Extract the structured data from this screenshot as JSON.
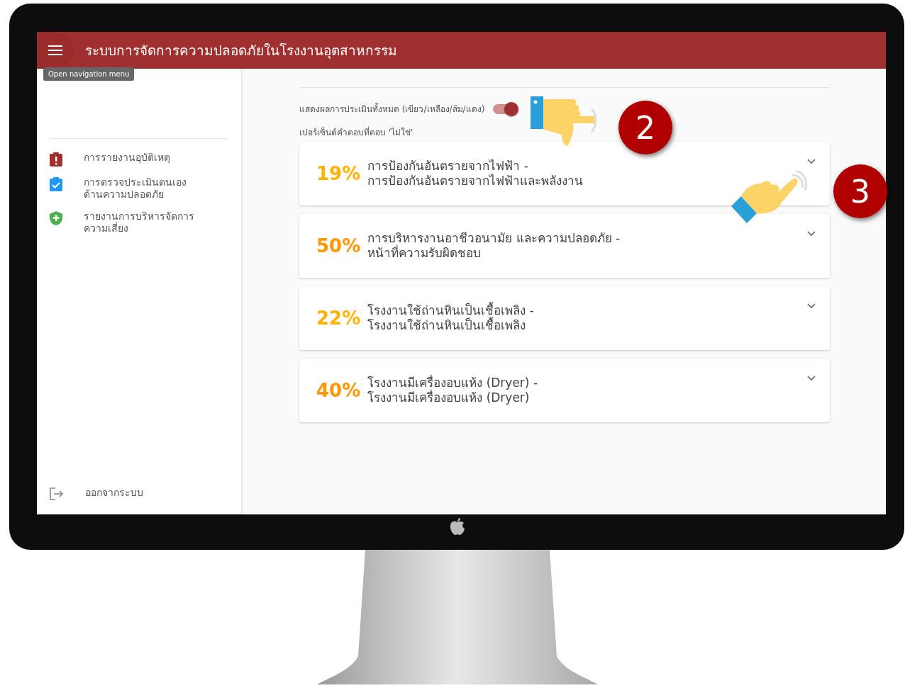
{
  "app_bar": {
    "title": "ระบบการจัดการความปลอดภัยในโรงงานอุตสาหกรรม",
    "tooltip": "Open navigation menu"
  },
  "sidebar": {
    "items": [
      {
        "kind": "alert",
        "label": "การรายงานอุบัติเหตุ"
      },
      {
        "kind": "check",
        "label": "การตรวจประเมินตนเอง ด้านความปลอดภัย"
      },
      {
        "kind": "shield",
        "label": "รายงานการบริหารจัดการ ความเสี่ยง"
      }
    ],
    "logout": {
      "label": "ออกจากระบบ"
    }
  },
  "toggle": {
    "label": "แสดงผลการประเมินทั้งหมด (เขียว/เหลือง/ส้ม/แดง)",
    "on": true
  },
  "subtitle": "เปอร์เซ็นต์คำตอบที่ตอบ 'ไม่ใช่'",
  "cards": [
    {
      "percent": "19%",
      "color": "#ffb300",
      "line_1": "การป้องกันอันตรายจากไฟฟ้า -",
      "line_2": "การป้องกันอันตรายจากไฟฟ้าและพลังงาน"
    },
    {
      "percent": "50%",
      "color": "#ff9800",
      "line_1": "การบริหารงานอาชีวอนามัย และความปลอดภัย -",
      "line_2": "หน้าที่ความรับผิดชอบ"
    },
    {
      "percent": "22%",
      "color": "#ffb300",
      "line_1": "โรงงานใช้ถ่านหินเป็นเชื้อเพลิง -",
      "line_2": "โรงงานใช้ถ่านหินเป็นเชื้อเพลิง"
    },
    {
      "percent": "40%",
      "color": "#ff9800",
      "line_1": "โรงงานมีเครื่องอบแห้ง (Dryer) -",
      "line_2": "โรงงานมีเครื่องอบแห้ง (Dryer)"
    }
  ],
  "callouts": [
    "2",
    "3"
  ]
}
